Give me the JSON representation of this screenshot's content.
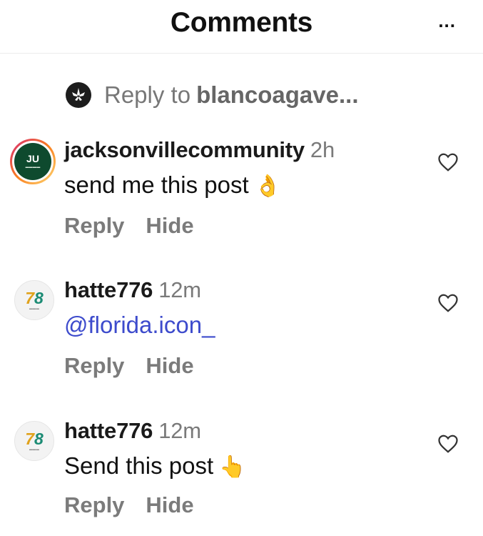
{
  "header": {
    "title": "Comments",
    "more_label": "..."
  },
  "reply_to": {
    "prefix": "Reply to",
    "username": "blancoagave..."
  },
  "comments": [
    {
      "username": "jacksonvillecommunity",
      "time": "2h",
      "text": "send me this post",
      "emoji": "👌",
      "avatar": "JU",
      "reply_label": "Reply",
      "hide_label": "Hide"
    },
    {
      "username": "hatte776",
      "time": "12m",
      "text": "@florida.icon_",
      "avatar": "78",
      "reply_label": "Reply",
      "hide_label": "Hide"
    },
    {
      "username": "hatte776",
      "time": "12m",
      "text": "Send this post",
      "emoji": "👆",
      "avatar": "78",
      "reply_label": "Reply",
      "hide_label": "Hide"
    }
  ],
  "colors": {
    "mention": "#3d4bcc",
    "meta": "#7b7b7b",
    "ring": "#d62976"
  }
}
